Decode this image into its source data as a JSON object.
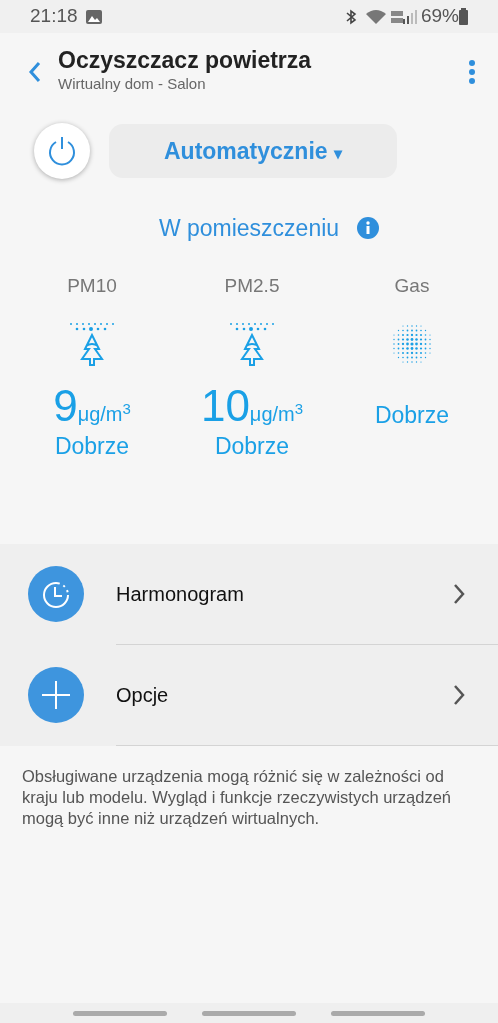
{
  "status_bar": {
    "time": "21:18",
    "battery": "69%"
  },
  "header": {
    "title": "Oczyszczacz powietrza",
    "subtitle": "Wirtualny dom - Salon"
  },
  "mode": {
    "label": "Automatycznie",
    "caret": "▾"
  },
  "section": {
    "title": "W pomieszczeniu"
  },
  "sensors": [
    {
      "name": "PM10",
      "kind": "particles",
      "value": "9",
      "unit": "μg/m$^{3}$",
      "status": "Dobrze"
    },
    {
      "name": "PM2.5",
      "kind": "particles",
      "value": "10",
      "unit": "μg/m$^{3}$",
      "status": "Dobrze"
    },
    {
      "name": "Gas",
      "kind": "gas",
      "status": "Dobrze"
    }
  ],
  "menu": [
    {
      "label": "Harmonogram",
      "kind": "schedule"
    },
    {
      "label": "Opcje",
      "kind": "add"
    }
  ],
  "note": "Obsługiwane urządzenia mogą różnić się w zależności od kraju lub modelu. Wygląd i funkcje rzeczywistych urządzeń mogą być inne niż urządzeń wirtualnych."
}
